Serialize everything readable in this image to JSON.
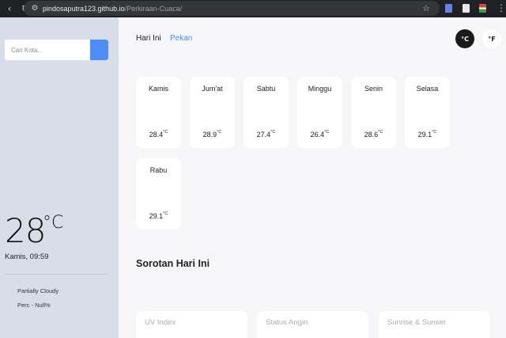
{
  "browser": {
    "url_host": "pindosaputra123.github.io",
    "url_path": "/Perkiraan-Cuaca/"
  },
  "sidebar": {
    "search_placeholder": "Cari Kota...",
    "current_temp": "28",
    "current_unit": "°C",
    "datetime": "Kamis, 09:59",
    "condition": "Partially Cloudy",
    "precip": "Perc - Null%"
  },
  "tabs": {
    "today": "Hari Ini",
    "week": "Pekan"
  },
  "units": {
    "celsius": "°C",
    "fahrenheit": "°F"
  },
  "forecast": [
    {
      "day": "Kamis",
      "temp": "28.4",
      "unit": "°C"
    },
    {
      "day": "Jum'at",
      "temp": "28.9",
      "unit": "°C"
    },
    {
      "day": "Sabtu",
      "temp": "27.4",
      "unit": "°C"
    },
    {
      "day": "Minggu",
      "temp": "26.4",
      "unit": "°C"
    },
    {
      "day": "Senin",
      "temp": "28.6",
      "unit": "°C"
    },
    {
      "day": "Selasa",
      "temp": "29.1",
      "unit": "°C"
    },
    {
      "day": "Rabu",
      "temp": "29.1",
      "unit": "°C"
    }
  ],
  "highlights": {
    "title": "Sorotan Hari Ini",
    "cards": [
      "UV Index",
      "Status Angin",
      "Sunrise & Sunset"
    ]
  },
  "colors": {
    "accent": "#4c8df6",
    "sidebar_bg": "#d8dee9",
    "main_bg": "#f6f6f8"
  }
}
